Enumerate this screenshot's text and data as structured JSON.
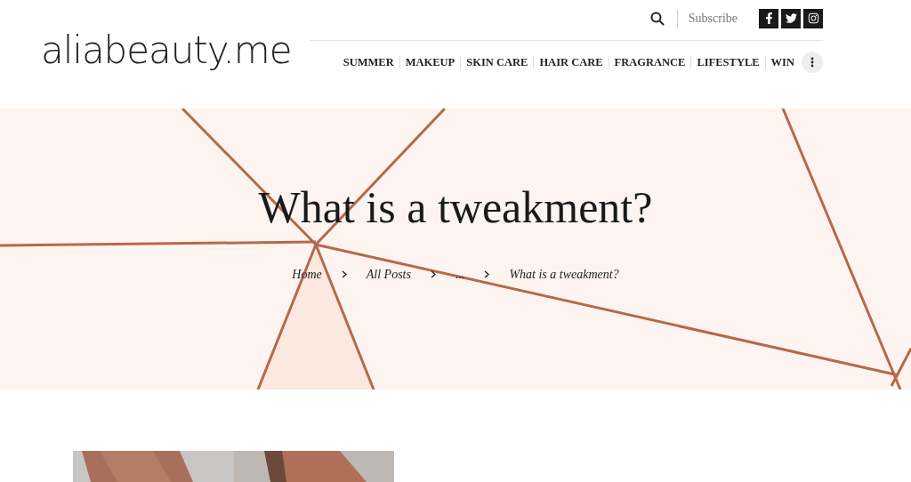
{
  "header": {
    "logo": "aliabeauty.me",
    "subscribe": "Subscribe",
    "social": [
      {
        "kind": "facebook"
      },
      {
        "kind": "twitter"
      },
      {
        "kind": "instagram"
      }
    ],
    "nav": [
      "SUMMER",
      "MAKEUP",
      "SKIN CARE",
      "HAIR CARE",
      "FRAGRANCE",
      "LIFESTYLE",
      "WIN"
    ]
  },
  "hero": {
    "title": "What is a tweakment?",
    "breadcrumb": [
      "Home",
      "All Posts",
      "...",
      "What is a tweakment?"
    ]
  }
}
